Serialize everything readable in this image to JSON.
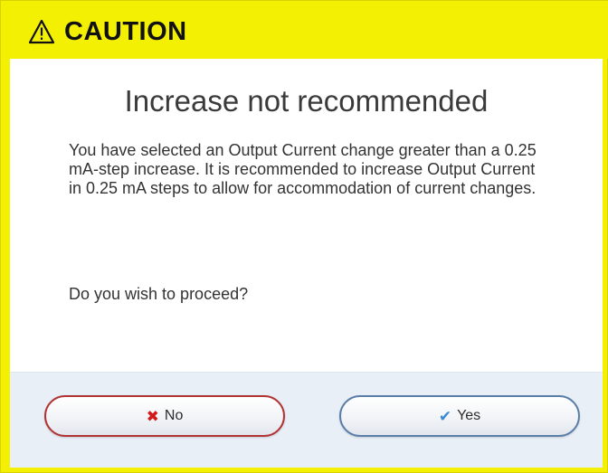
{
  "header": {
    "icon": "warning-triangle-icon",
    "title": "CAUTION",
    "background_color": "#f4f004"
  },
  "dialog": {
    "heading": "Increase not recommended",
    "message": "You have selected an Output Current change greater than a 0.25 mA-step increase.  It is recommended to increase Output Current in 0.25 mA steps to allow for accommodation of current changes.",
    "question": "Do you wish to proceed?"
  },
  "buttons": {
    "no": {
      "label": "No",
      "icon": "x-icon",
      "icon_glyph": "✖",
      "border_color": "#b03434"
    },
    "yes": {
      "label": "Yes",
      "icon": "checkmark-icon",
      "icon_glyph": "✔",
      "border_color": "#5a7ea8"
    }
  }
}
